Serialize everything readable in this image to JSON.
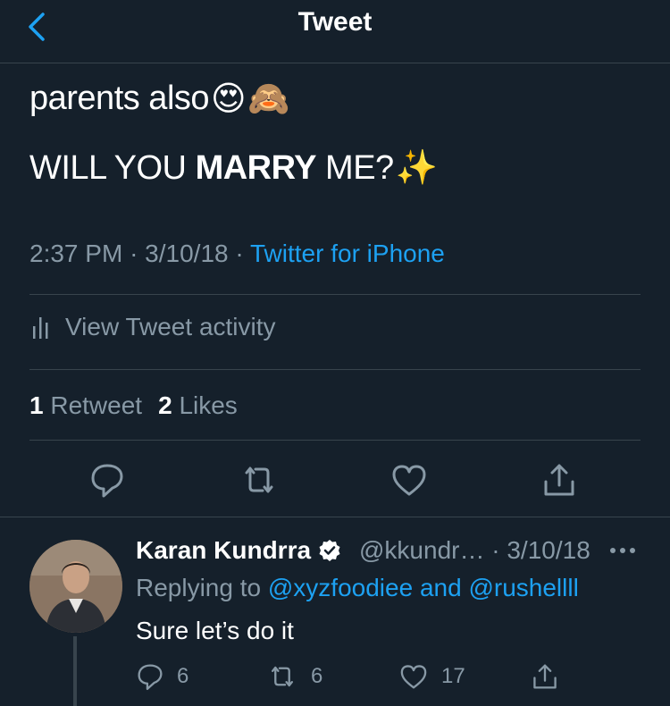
{
  "header": {
    "title": "Tweet"
  },
  "tweet": {
    "line1": "parents also",
    "line1_emojis": [
      "😍",
      "🙈"
    ],
    "line2_pre": "WILL YOU ",
    "line2_bold": "MARRY",
    "line2_post": " ME?",
    "line2_emoji": "✨",
    "time": "2:37 PM",
    "date": "3/10/18",
    "separator": "·",
    "source": "Twitter for iPhone",
    "activity_label": "View Tweet activity",
    "retweet_count": "1",
    "retweet_label": "Retweet",
    "likes_count": "2",
    "likes_label": "Likes"
  },
  "reply": {
    "name": "Karan Kundrra",
    "handle_date": "@kkundr… · 3/10/18",
    "replying_prefix": "Replying to ",
    "mention1": "@xyzfoodiee",
    "and": " and ",
    "mention2": "@rushellll",
    "text": "Sure let’s do it",
    "reply_count": "6",
    "retweet_count": "6",
    "like_count": "17"
  },
  "colors": {
    "background": "#15202b",
    "divider": "#38444d",
    "muted": "#8899a6",
    "accent": "#1da1f2"
  },
  "icons": [
    "back-chevron-icon",
    "bar-chart-icon",
    "reply-icon",
    "retweet-icon",
    "like-icon",
    "share-icon",
    "verified-badge-icon",
    "more-icon"
  ]
}
